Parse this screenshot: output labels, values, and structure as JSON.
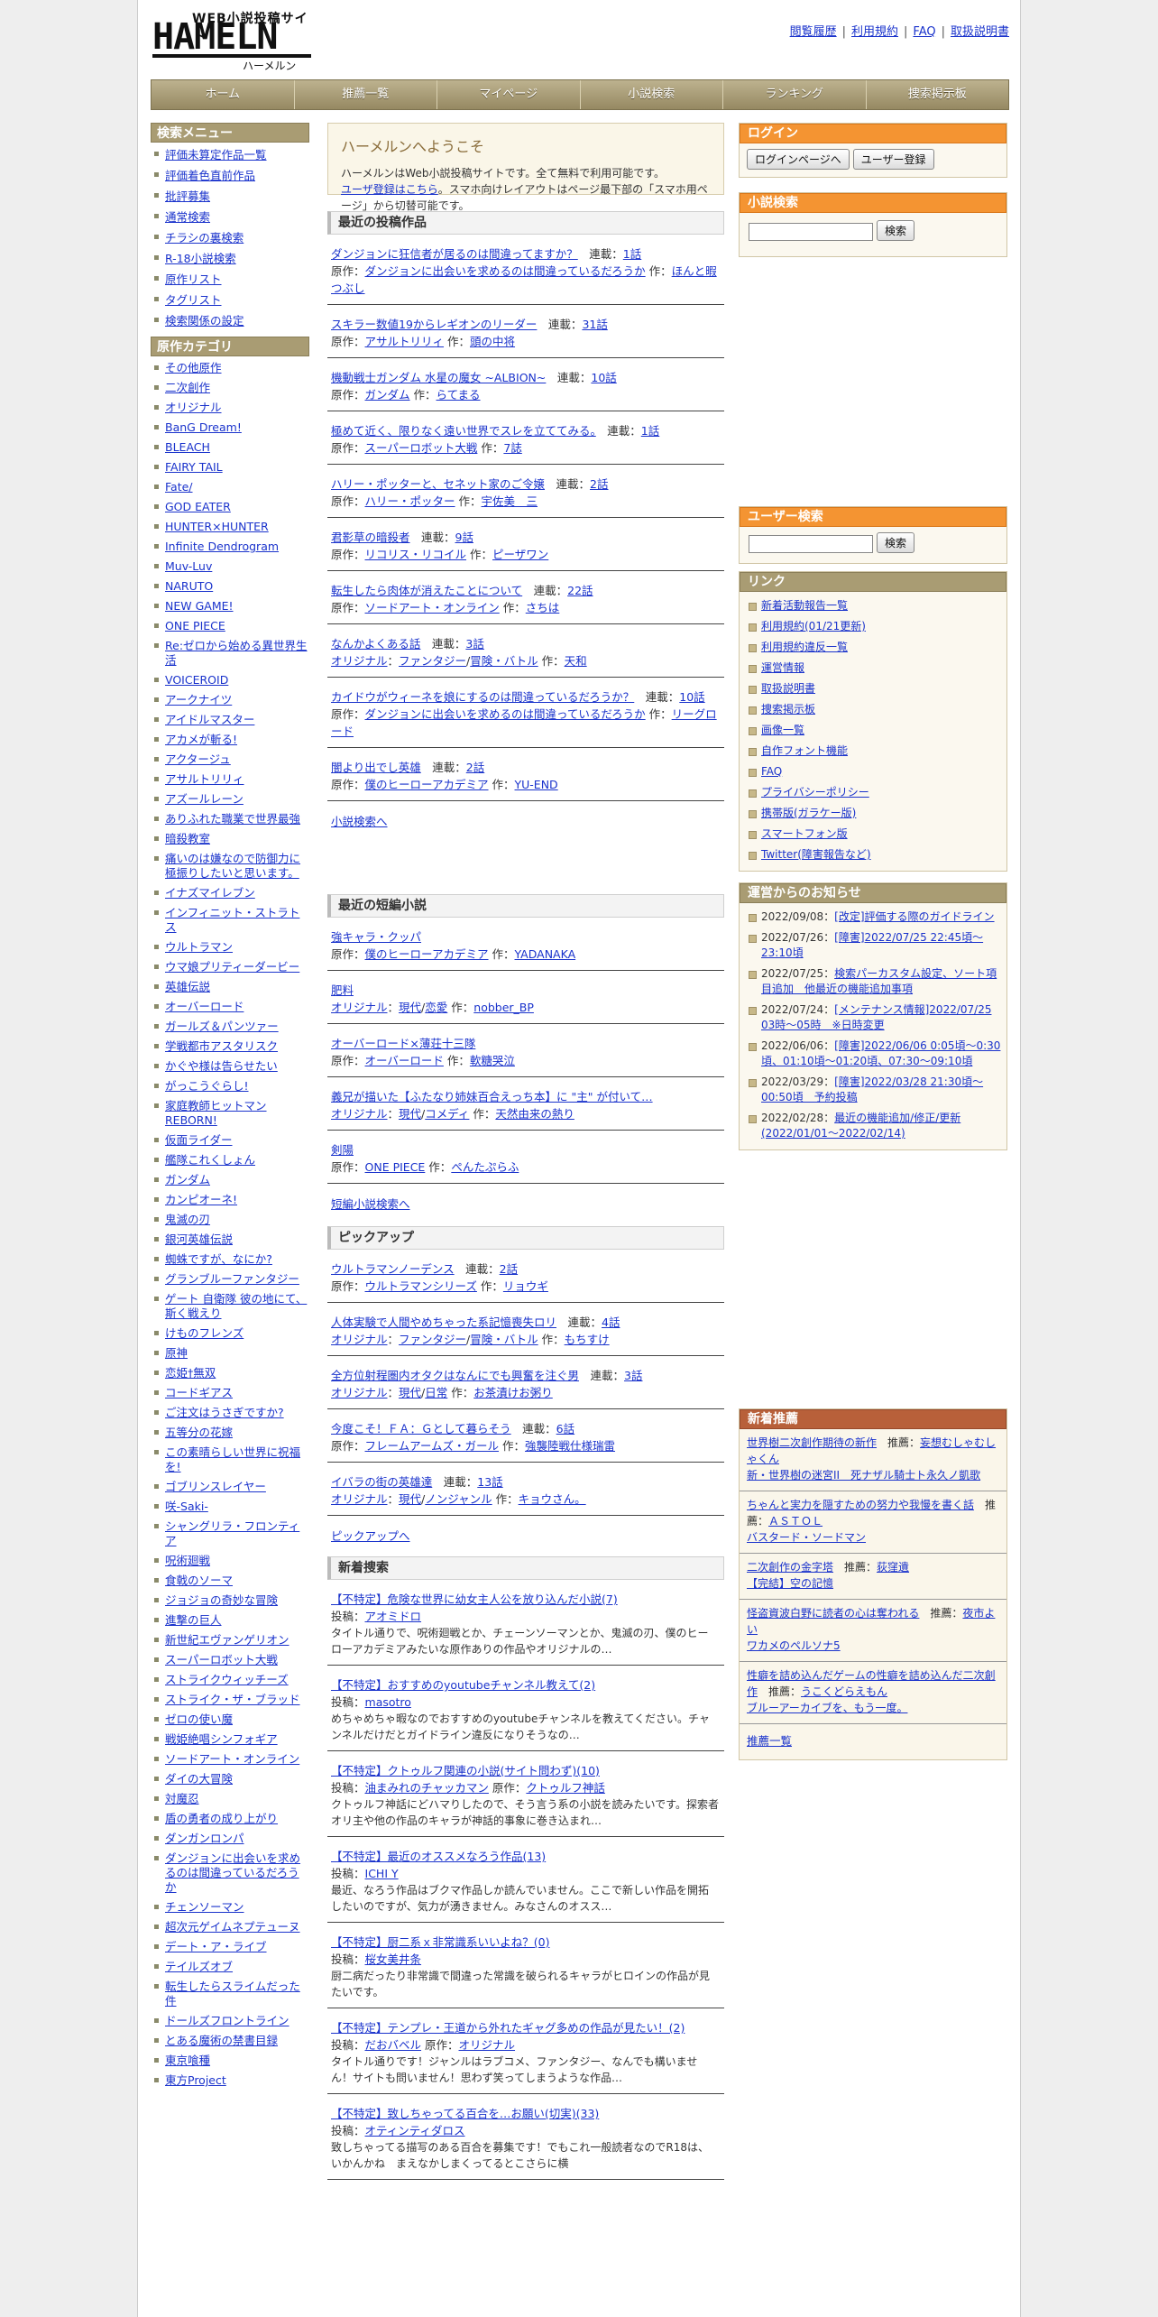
{
  "site": {
    "logo_line1": "WEB小説投稿サイト",
    "logo_line2": "HAMELN",
    "logo_line3": "ハーメルン"
  },
  "toplinks": [
    "閲覧履歴",
    "利用規約",
    "FAQ",
    "取扱説明書"
  ],
  "gnav": [
    "ホーム",
    "推薦一覧",
    "マイページ",
    "小説検索",
    "ランキング",
    "捜索掲示板"
  ],
  "search_menu": {
    "title": "検索メニュー",
    "items": [
      "評価未算定作品一覧",
      "評価着色直前作品",
      "批評募集",
      "通常検索",
      "チラシの裏検索",
      "R-18小説検索",
      "原作リスト",
      "タグリスト",
      "検索関係の設定"
    ]
  },
  "categories": {
    "title": "原作カテゴリ",
    "items": [
      "その他原作",
      "二次創作",
      "オリジナル",
      "BanG Dream!",
      "BLEACH",
      "FAIRY TAIL",
      "Fate/",
      "GOD EATER",
      "HUNTER×HUNTER",
      "Infinite Dendrogram",
      "Muv-Luv",
      "NARUTO",
      "NEW GAME!",
      "ONE PIECE",
      "Re:ゼロから始める異世界生活",
      "VOICEROID",
      "アークナイツ",
      "アイドルマスター",
      "アカメが斬る!",
      "アクタージュ",
      "アサルトリリィ",
      "アズールレーン",
      "ありふれた職業で世界最強",
      "暗殺教室",
      "痛いのは嫌なので防御力に極振りしたいと思います。",
      "イナズマイレブン",
      "インフィニット・ストラトス",
      "ウルトラマン",
      "ウマ娘プリティーダービー",
      "英雄伝説",
      "オーバーロード",
      "ガールズ＆パンツァー",
      "学戦都市アスタリスク",
      "かぐや様は告らせたい",
      "がっこうぐらし!",
      "家庭教師ヒットマンREBORN!",
      "仮面ライダー",
      "艦隊これくしょん",
      "ガンダム",
      "カンピオーネ!",
      "鬼滅の刃",
      "銀河英雄伝説",
      "蜘蛛ですが、なにか?",
      "グランブルーファンタジー",
      "ゲート 自衛隊 彼の地にて、斯く戦えり",
      "けものフレンズ",
      "原神",
      "恋姫†無双",
      "コードギアス",
      "ご注文はうさぎですか?",
      "五等分の花嫁",
      "この素晴らしい世界に祝福を!",
      "ゴブリンスレイヤー",
      "咲-Saki-",
      "シャングリラ・フロンティア",
      "呪術廻戦",
      "食戟のソーマ",
      "ジョジョの奇妙な冒険",
      "進撃の巨人",
      "新世紀エヴァンゲリオン",
      "スーパーロボット大戦",
      "ストライクウィッチーズ",
      "ストライク・ザ・ブラッド",
      "ゼロの使い魔",
      "戦姫絶唱シンフォギア",
      "ソードアート・オンライン",
      "ダイの大冒険",
      "対魔忍",
      "盾の勇者の成り上がり",
      "ダンガンロンパ",
      "ダンジョンに出会いを求めるのは間違っているだろうか",
      "チェンソーマン",
      "超次元ゲイムネプテューヌ",
      "デート・ア・ライブ",
      "テイルズオブ",
      "転生したらスライムだった件",
      "ドールズフロントライン",
      "とある魔術の禁書目録",
      "東京喰種",
      "東方Project"
    ]
  },
  "welcome": {
    "title": "ハーメルンへようこそ",
    "line1": "ハーメルンはWeb小説投稿サイトです。全て無料で利用可能です。",
    "link": "ユーザ登録はこちら",
    "line2": "。スマホ向けレイアウトはページ最下部の「スマホ用ページ」から切替可能です。"
  },
  "recent": {
    "title": "最近の投稿作品",
    "labels": {
      "serial": "連載：",
      "origin": "原作：",
      "author": "作：",
      "original": "オリジナル："
    },
    "items": [
      {
        "t": "ダンジョンに狂信者が居るのは間違ってますか？",
        "n": "1話",
        "o": "ダンジョンに出会いを求めるのは間違っているだろうか",
        "a": "ほんと暇つぶし"
      },
      {
        "t": "スキラー数値19からレギオンのリーダー",
        "n": "31話",
        "o": "アサルトリリィ",
        "a": "頭の中将"
      },
      {
        "t": "機動戦士ガンダム 水星の魔女 ~ALBION~",
        "n": "10話",
        "o": "ガンダム",
        "a": "らてまる"
      },
      {
        "t": "極めて近く、限りなく遠い世界でスレを立ててみる。",
        "n": "1話",
        "o": "スーパーロボット大戦",
        "a": "7誌"
      },
      {
        "t": "ハリー・ポッターと、セネット家のご令嬢",
        "n": "2話",
        "o": "ハリー・ポッター",
        "a": "宇佐美　三"
      },
      {
        "t": "君影草の暗殺者",
        "n": "9話",
        "o": "リコリス・リコイル",
        "a": "ピーザワン"
      },
      {
        "t": "転生したら肉体が消えたことについて",
        "n": "22話",
        "o": "ソードアート・オンライン",
        "a": "さちは"
      },
      {
        "t": "なんかよくある話",
        "n": "3話",
        "g1": "ファンタジー",
        "g2": "冒険・バトル",
        "a": "天和"
      },
      {
        "t": "カイドウがウィーネを娘にするのは間違っているだろうか？",
        "n": "10話",
        "o": "ダンジョンに出会いを求めるのは間違っているだろうか",
        "a": "リーグロード"
      },
      {
        "t": "闇より出でし英雄",
        "n": "2話",
        "o": "僕のヒーローアカデミア",
        "a": "YU-END"
      }
    ],
    "more": "小説検索へ"
  },
  "short": {
    "title": "最近の短編小説",
    "items": [
      {
        "t": "強キャラ・クッパ",
        "o": "僕のヒーローアカデミア",
        "a": "YADANAKA"
      },
      {
        "t": "肥料",
        "g1": "現代",
        "g2": "恋愛",
        "a": "nobber_BP"
      },
      {
        "t": "オーバーロード×薄荘十三隊",
        "o": "オーバーロード",
        "a": "軟糖哭泣"
      },
      {
        "t": "義兄が描いた【ふたなり姉妹百合えっち本】に \"主\" が付いて…",
        "g1": "現代",
        "g2": "コメディ",
        "a": "天然由来の熱り"
      },
      {
        "t": "剣陽",
        "o": "ONE PIECE",
        "a": "ぺんたぷらふ"
      }
    ],
    "more": "短編小説検索へ"
  },
  "pickup": {
    "title": "ピックアップ",
    "items": [
      {
        "t": "ウルトラマンノーデンス",
        "n": "2話",
        "o": "ウルトラマンシリーズ",
        "a": "リョウギ"
      },
      {
        "t": "人体実験で人間やめちゃった系記憶喪失ロリ",
        "n": "4話",
        "g1": "ファンタジー",
        "g2": "冒険・バトル",
        "a": "もちすけ"
      },
      {
        "t": "全方位射程圏内オタクはなんにでも興奮を注ぐ男",
        "n": "3話",
        "g1": "現代",
        "g2": "日常",
        "a": "お茶漬けお粥り"
      },
      {
        "t": "今度こそ！ＦＡ：Ｇとして暮らそう",
        "n": "6話",
        "o": "フレームアームズ・ガール",
        "a": "強襲陸戦仕様瑞雷"
      },
      {
        "t": "イバラの街の英雄達",
        "n": "13話",
        "g1": "現代",
        "g2": "ノンジャンル",
        "a": "キョウさん。"
      }
    ],
    "more": "ピックアップへ"
  },
  "search_bbs": {
    "title": "新着捜索",
    "post": "投稿：",
    "origin": "原作：",
    "items": [
      {
        "t": "【不特定】危険な世界に幼女主人公を放り込んだ小説(7)",
        "u": "アオミドロ",
        "d": "タイトル通りで、呪術廻戦とか、チェーンソーマンとか、鬼滅の刃、僕のヒーローアカデミアみたいな原作ありの作品やオリジナルの…"
      },
      {
        "t": "【不特定】おすすめのyoutubeチャンネル教えて(2)",
        "u": "masotro",
        "d": "めちゃめちゃ暇なのでおすすめのyoutubeチャンネルを教えてください。チャンネルだけだとガイドライン違反になりそうなの…"
      },
      {
        "t": "【不特定】クトゥルフ関連の小説(サイト問わず)(10)",
        "u": "油まみれのチャッカマン",
        "o": "クトゥルフ神話",
        "d": "クトゥルフ神話にどハマりしたので、そう言う系の小説を読みたいです。探索者オリ主や他の作品のキャラが神話的事象に巻き込まれ…"
      },
      {
        "t": "【不特定】最近のオススメなろう作品(13)",
        "u": "ICHI Y",
        "d": "最近、なろう作品はブクマ作品しか読んでいません。ここで新しい作品を開拓したいのですが、気力が湧きません。みなさんのオスス…"
      },
      {
        "t": "【不特定】厨二系ｘ非常識系いいよね？(0)",
        "u": "桜女美井条",
        "d": "厨二病だったり非常識で間違った常識を破られるキャラがヒロインの作品が見たいです。"
      },
      {
        "t": "【不特定】テンプレ・王道から外れたギャグ多めの作品が見たい！(2)",
        "u": "だおバベル",
        "o": "オリジナル",
        "d": "タイトル通りです！ジャンルはラブコメ、ファンタジー、なんでも構いません！サイトも問いません！思わず笑ってしまうような作品…"
      },
      {
        "t": "【不特定】致しちゃってる百合を…お願い(切実)(33)",
        "u": "オティンティダロス",
        "d": "致しちゃってる描写のある百合を募集です！でもこれ一般読者なのでR18は、いかんかね　まえなかしまくってるとこさらに横"
      }
    ]
  },
  "login": {
    "title": "ログイン",
    "btn1": "ログインページへ",
    "btn2": "ユーザー登録"
  },
  "nsearch": {
    "title": "小説検索",
    "btn": "検索"
  },
  "usearch": {
    "title": "ユーザー検索",
    "btn": "検索"
  },
  "links": {
    "title": "リンク",
    "items": [
      "新着活動報告一覧",
      "利用規約(01/21更新)",
      "利用規約違反一覧",
      "運営情報",
      "取扱説明書",
      "捜索掲示板",
      "画像一覧",
      "自作フォント機能",
      "FAQ",
      "プライバシーポリシー",
      "携帯版(ガラケー版)",
      "スマートフォン版",
      "Twitter(障害報告など)"
    ]
  },
  "news": {
    "title": "運営からのお知らせ",
    "items": [
      {
        "d": "2022/09/08：",
        "t": "[改定]評価する際のガイドライン"
      },
      {
        "d": "2022/07/26：",
        "t": "[障害]2022/07/25 22:45頃～23:10頃"
      },
      {
        "d": "2022/07/25：",
        "t": "検索パーカスタム設定、ソート項目追加　他最近の機能追加事項"
      },
      {
        "d": "2022/07/24：",
        "t": "[メンテナンス情報]2022/07/25 03時～05時　※日時変更"
      },
      {
        "d": "2022/06/06：",
        "t": "[障害]2022/06/06 0:05頃～0:30頃、01:10頃～01:20頃、07:30～09:10頃"
      },
      {
        "d": "2022/03/29：",
        "t": "[障害]2022/03/28 21:30頃～00:50頃　予約投稿"
      },
      {
        "d": "2022/02/28：",
        "t": "最近の機能追加/修正/更新(2022/01/01～2022/02/14)"
      }
    ]
  },
  "recommend": {
    "title": "新着推薦",
    "label": "推薦：",
    "items": [
      {
        "t": "世界樹二次創作期待の新作",
        "u": "妄想むしゃむしゃくん",
        "sub": "新・世界樹の迷宮II　死ナザル騎士ト永久ノ凱歌"
      },
      {
        "t": "ちゃんと実力を隠すための努力や我慢を書く話",
        "u": "ＡＳＴＯＬ",
        "sub": "バスタード・ソードマン"
      },
      {
        "t": "二次創作の金字塔",
        "u": "荻窪遺",
        "sub": "【完結】空の記憶"
      },
      {
        "t": "怪盗資波白野に読者の心は奪われる",
        "u": "夜市よい",
        "sub": "ワカメのペルソナ5"
      },
      {
        "t": "性癖を詰め込んだゲームの性癖を詰め込んだ二次創作",
        "u": "うこくどらえもん",
        "sub": "ブルーアーカイブを、もう一度。"
      }
    ],
    "more": "推薦一覧"
  }
}
